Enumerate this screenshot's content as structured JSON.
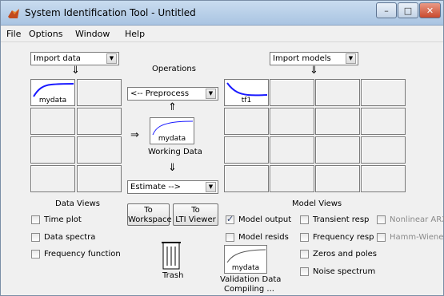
{
  "window": {
    "title": "System Identification Tool - Untitled",
    "controls": {
      "minimize": "–",
      "maximize": "□",
      "close": "✕"
    }
  },
  "menu": [
    "File",
    "Options",
    "Window",
    "Help"
  ],
  "left": {
    "import_data": "Import data",
    "data_slot_label": "mydata",
    "data_views_label": "Data Views",
    "checkboxes": [
      {
        "label": "Time plot",
        "checked": false
      },
      {
        "label": "Data spectra",
        "checked": false
      },
      {
        "label": "Frequency function",
        "checked": false
      }
    ]
  },
  "center": {
    "operations_label": "Operations",
    "preprocess": "<-- Preprocess",
    "working_slot_label": "mydata",
    "working_data_label": "Working Data",
    "estimate": "Estimate -->",
    "to_workspace": "To Workspace",
    "to_workspace_l1": "To",
    "to_workspace_l2": "Workspace",
    "to_lti_l1": "To",
    "to_lti_l2": "LTI Viewer",
    "trash_label": "Trash"
  },
  "right": {
    "import_models": "Import models",
    "model_slot_label": "tf1",
    "model_views_label": "Model Views",
    "checkboxes": [
      {
        "label": "Model output",
        "checked": true,
        "enabled": true
      },
      {
        "label": "Model resids",
        "checked": false,
        "enabled": true
      },
      {
        "label": "Transient resp",
        "checked": false,
        "enabled": true
      },
      {
        "label": "Frequency resp",
        "checked": false,
        "enabled": true
      },
      {
        "label": "Zeros and poles",
        "checked": false,
        "enabled": true
      },
      {
        "label": "Noise spectrum",
        "checked": false,
        "enabled": true
      },
      {
        "label": "Nonlinear ARX",
        "checked": false,
        "enabled": false
      },
      {
        "label": "Hamm-Wiener",
        "checked": false,
        "enabled": false
      }
    ],
    "validation_slot_label": "mydata",
    "validation_label": "Validation Data",
    "status": "Compiling ..."
  },
  "colors": {
    "curve": "#1a1aff",
    "accent_title": "#c9dcef"
  }
}
